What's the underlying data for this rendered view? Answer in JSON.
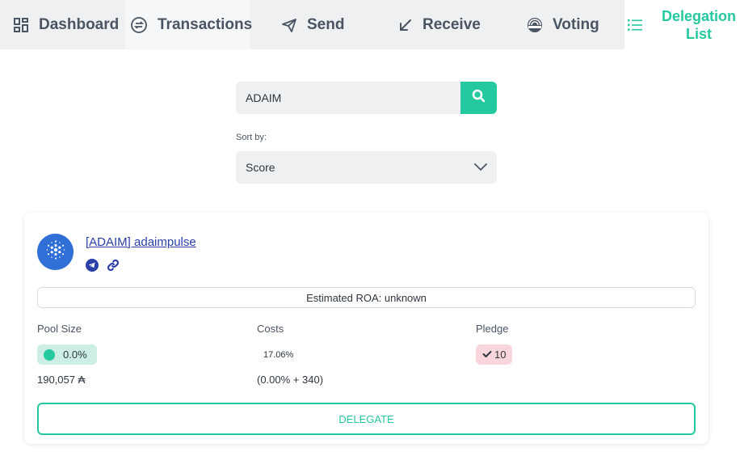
{
  "nav": {
    "tabs": [
      {
        "label": "Dashboard",
        "icon": "dashboard-grid-icon"
      },
      {
        "label": "Transactions",
        "icon": "transactions-icon"
      },
      {
        "label": "Send",
        "icon": "paper-plane-icon"
      },
      {
        "label": "Receive",
        "icon": "arrow-down-left-icon"
      },
      {
        "label": "Voting",
        "icon": "voting-icon"
      },
      {
        "label_line1": "Delegation",
        "label_line2": "List",
        "icon": "list-icon",
        "active": true
      }
    ]
  },
  "search": {
    "value": "ADAIM",
    "placeholder": "",
    "button_icon": "search-icon"
  },
  "sort": {
    "label": "Sort by:",
    "selected": "Score"
  },
  "pool": {
    "name": "[ADAIM] adaimpulse",
    "links": [
      "telegram-icon",
      "link-icon"
    ],
    "roa": "Estimated ROA: unknown",
    "headers": {
      "size": "Pool Size",
      "costs": "Costs",
      "pledge": "Pledge"
    },
    "size_percent": "0.0%",
    "size_amount": "190,057 ₳",
    "costs_percent": "17.06%",
    "costs_detail": "(0.00% + 340)",
    "pledge_value": "10",
    "delegate_label": "DELEGATE"
  },
  "colors": {
    "accent": "#25c9a0",
    "nav_bg": "#eef0f2",
    "pledge_bg": "#f9d5dc",
    "size_bg": "#cdeee4",
    "avatar_bg": "#2f6fd6",
    "link": "#2b3fa8"
  }
}
